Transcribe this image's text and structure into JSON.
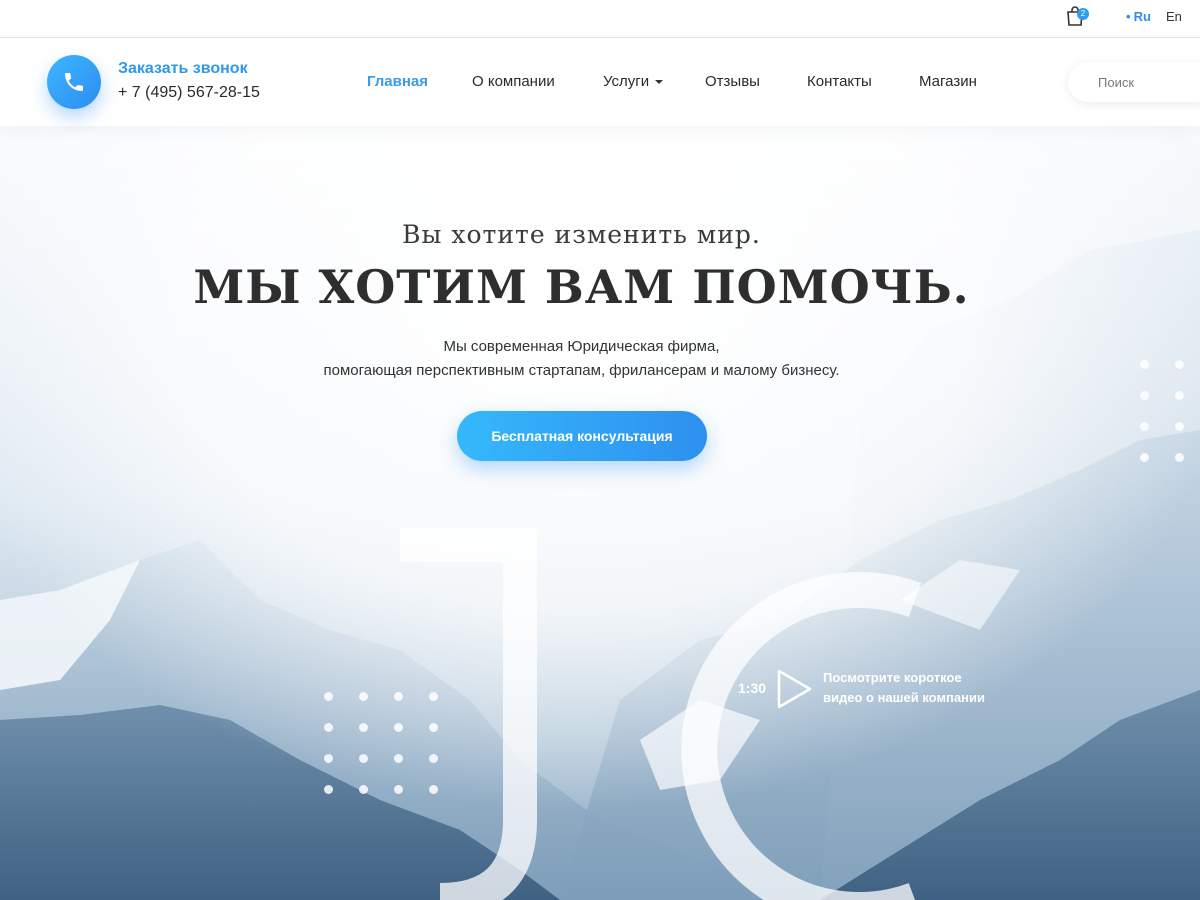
{
  "topbar": {
    "cart_icon": "shopping-bag-icon",
    "cart_count": "2",
    "languages": [
      "Ru",
      "En"
    ]
  },
  "header": {
    "phone_icon": "phone-icon",
    "callback_label": "Заказать звонок",
    "phone": "+ 7 (495) 567-28-15",
    "nav": [
      "Главная",
      "О компании",
      "Услуги",
      "Отзывы",
      "Контакты",
      "Магазин"
    ],
    "search_placeholder": "Поиск"
  },
  "hero": {
    "subtitle": "Вы хотите изменить мир.",
    "headline": "МЫ ХОТИМ ВАМ ПОМОЧЬ.",
    "description_line1": "Мы современная Юридическая фирма,",
    "description_line2": "помогающая перспективным стартапам, фрилансерам и малому бизнесу.",
    "cta_label": "Бесплатная консультация"
  },
  "video": {
    "duration": "1:30",
    "play_icon": "play-icon",
    "text_line1": "Посмотрите короткое",
    "text_line2": "видео о нашей компании"
  },
  "colors": {
    "accent": "#2f98ea",
    "button_gradient_start": "#35b9fb",
    "button_gradient_end": "#2e8fef"
  }
}
